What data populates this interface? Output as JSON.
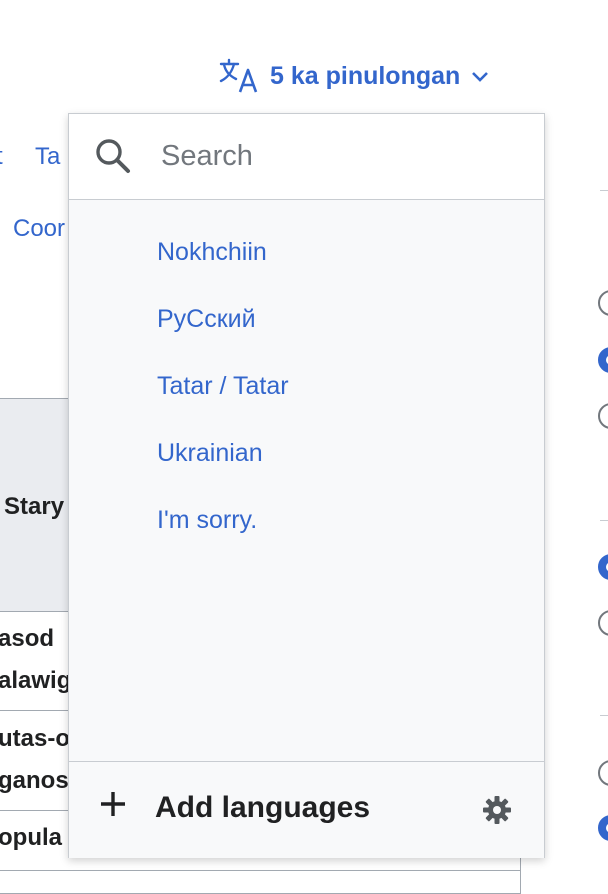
{
  "language_button": {
    "label": "5 ka pinulongan",
    "icon": "translate-icon",
    "chevron": "chevron-down-icon"
  },
  "background": {
    "tabs": [
      "t",
      "Ta"
    ],
    "coord_link": "Coor",
    "table_header": "Stary",
    "rows": [
      {
        "line1": "asod",
        "line2": "alawig"
      },
      {
        "line1": "utas-o",
        "line2": "ganos"
      },
      {
        "line1": "opula",
        "line2": ""
      }
    ]
  },
  "dropdown": {
    "search": {
      "placeholder": "Search",
      "value": "",
      "icon": "search-icon"
    },
    "languages": [
      "Nokhchiin",
      "РуСский",
      "Tatar / Tatar",
      "Ukrainian",
      "I'm sorry."
    ],
    "footer": {
      "add_label": "Add languages",
      "add_icon": "plus-icon",
      "settings_icon": "gear-icon"
    }
  },
  "colors": {
    "link": "#3366cc",
    "text": "#202122",
    "border": "#c8ccd1",
    "panel": "#f8f9fa"
  }
}
